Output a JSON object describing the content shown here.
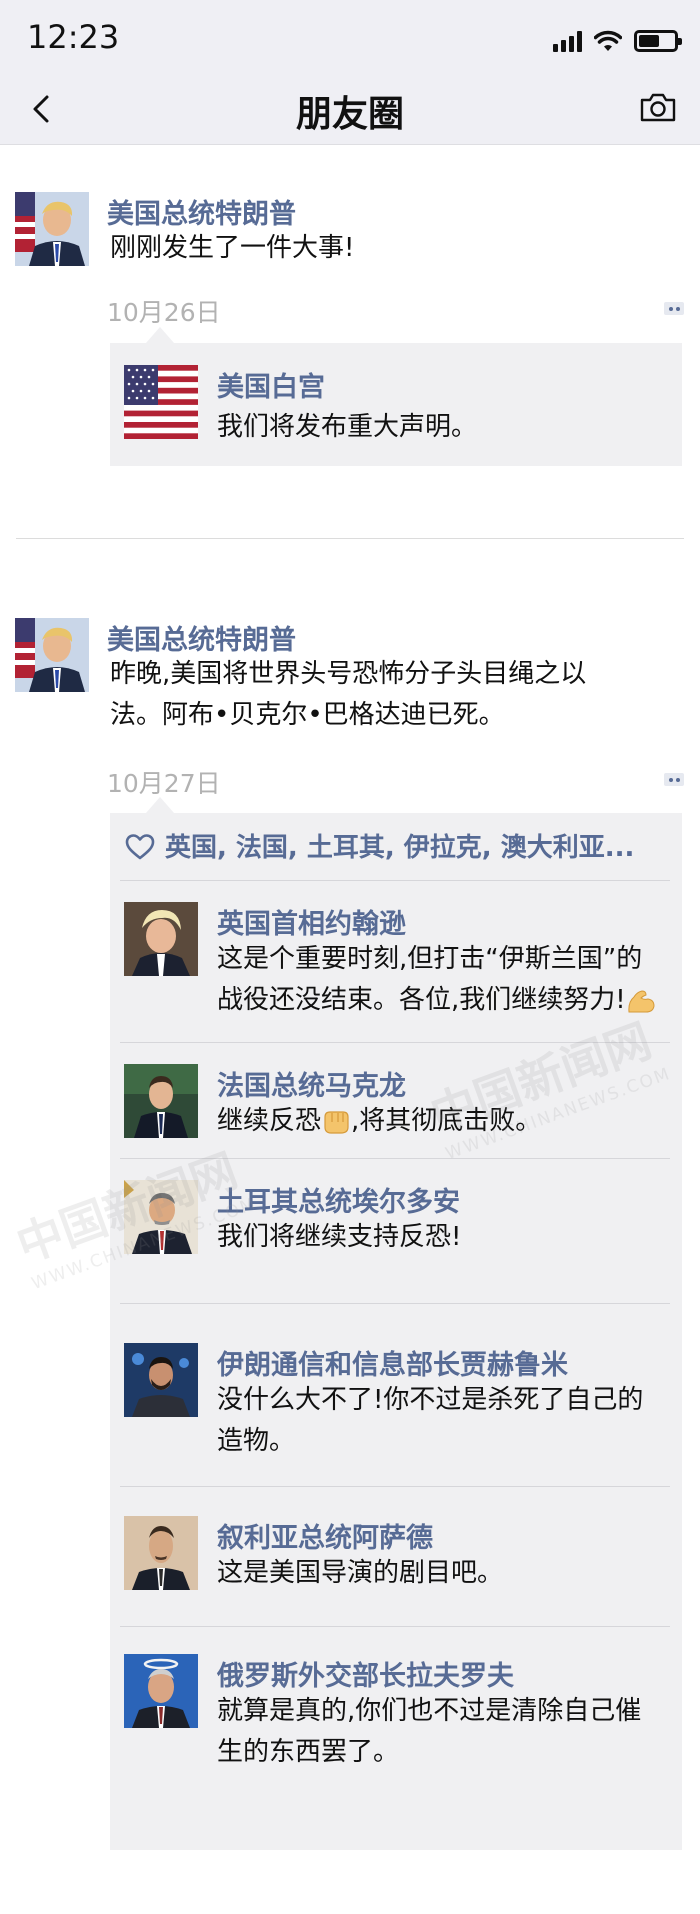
{
  "status_bar": {
    "time": "12:23",
    "battery_level": 0.55
  },
  "nav": {
    "back_icon": "chevron-left-icon",
    "title": "朋友圈",
    "camera_icon": "camera-icon"
  },
  "posts": [
    {
      "author": "美国总统特朗普",
      "text": "刚刚发生了一件大事!",
      "time": "10月26日",
      "share": {
        "title": "美国白宫",
        "desc": "我们将发布重大声明。",
        "thumb_icon": "us-flag-icon"
      }
    },
    {
      "author": "美国总统特朗普",
      "text_lines": [
        "昨晚,美国将世界头号恐怖分子头目绳之以",
        "法。阿布•贝克尔•巴格达迪已死。"
      ],
      "time": "10月27日",
      "likes": "英国, 法国, 土耳其, 伊拉克, 澳大利亚...",
      "comments": [
        {
          "name": "英国首相约翰逊",
          "lines": [
            "这是个重要时刻,但打击“伊斯兰国”的",
            "战役还没结束。各位,我们继续努力!"
          ],
          "emoji": "flexed-biceps-icon"
        },
        {
          "name": "法国总统马克龙",
          "pre": "继续反恐",
          "emoji": "fist-icon",
          "post": ",将其彻底击败。"
        },
        {
          "name": "土耳其总统埃尔多安",
          "lines": [
            "我们将继续支持反恐!"
          ]
        },
        {
          "name": "伊朗通信和信息部长贾赫鲁米",
          "lines": [
            "没什么大不了!你不过是杀死了自己的",
            "造物。"
          ]
        },
        {
          "name": "叙利亚总统阿萨德",
          "lines": [
            "这是美国导演的剧目吧。"
          ]
        },
        {
          "name": "俄罗斯外交部长拉夫罗夫",
          "lines": [
            "就算是真的,你们也不过是清除自己催",
            "生的东西罢了。"
          ]
        }
      ]
    }
  ],
  "watermarks": [
    {
      "text": "中国新闻网",
      "sub": "WWW.CHINANEWS.COM"
    },
    {
      "text": "中国新闻网",
      "sub": "WWW.CHINANEWS.COM"
    }
  ]
}
